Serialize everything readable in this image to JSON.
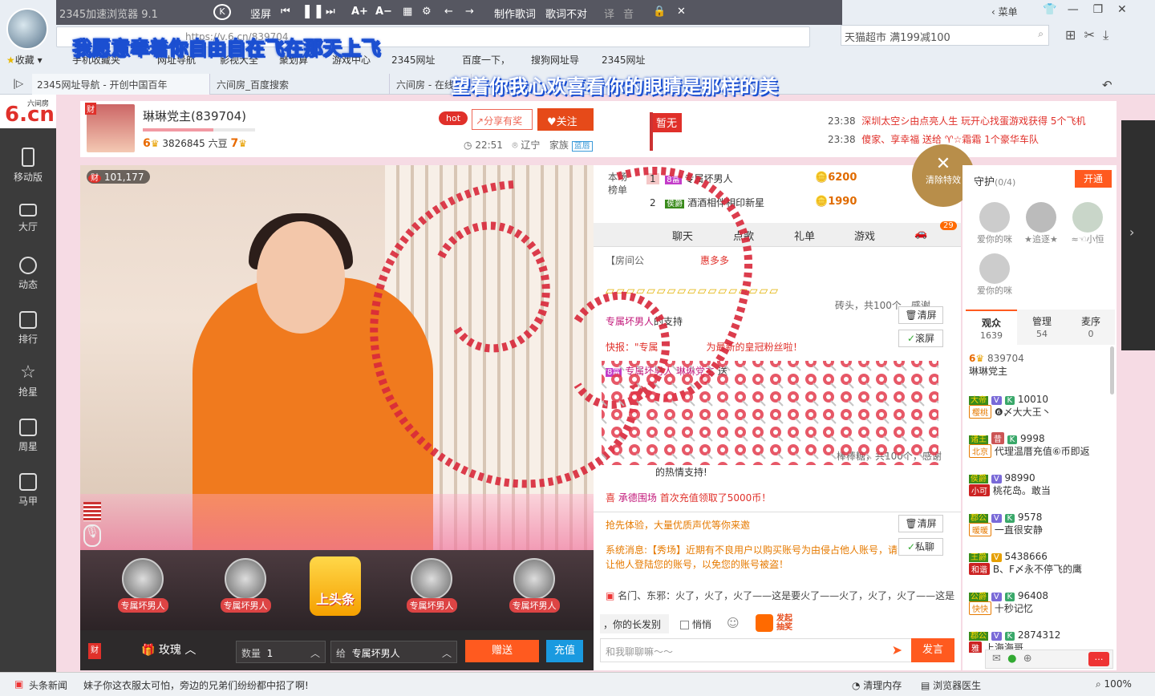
{
  "browser": {
    "app_title": "2345加速浏览器 9.1",
    "favorites": "收藏",
    "media_tools": {
      "vertical": "竖屏",
      "make_lyrics": "制作歌词",
      "lyrics_wrong": "歌词不对",
      "translate": "译",
      "sound": "音"
    },
    "address": "https://v.6.cn/839704",
    "search_placeholder": "天猫超市 满199减100",
    "menu": "菜单",
    "bookmarks": [
      "手机收藏夹",
      "网址导航",
      "影视大全",
      "聚划算",
      "游戏中心",
      "2345网址",
      "百度一下，",
      "搜狗网址导",
      "2345网址"
    ],
    "tabs": [
      "2345网址导航 - 开创中国百年",
      "六间房_百度搜索",
      "六间房 - 在线"
    ]
  },
  "lyrics": {
    "line1": "我愿意牵着你自由自在飞在那天上飞",
    "line2": "望着你我心欢喜看你的眼睛是那样的美"
  },
  "sidebar": [
    {
      "label": "移动版",
      "icon": "phone-icon"
    },
    {
      "label": "大厅",
      "icon": "tv-icon"
    },
    {
      "label": "动态",
      "icon": "compass-icon"
    },
    {
      "label": "排行",
      "icon": "crown-icon"
    },
    {
      "label": "抢星",
      "icon": "star-icon"
    },
    {
      "label": "周星",
      "icon": "gift-icon"
    },
    {
      "label": "马甲",
      "icon": "shirt-icon"
    }
  ],
  "site": {
    "logo_top": "六间房",
    "logo_main": "6.cn"
  },
  "anchor": {
    "name": "琳琳党主",
    "room_id": "(839704)",
    "level_left": "6",
    "beans": "3826845 六豆",
    "level_right": "7",
    "hot": "hot",
    "share": "分享有奖",
    "follow": "关注",
    "time": "22:51",
    "location": "辽宁",
    "family": "家族",
    "family_tag": "蓝唇",
    "status": "暂无"
  },
  "notices": [
    {
      "time": "23:38",
      "text": "深圳太空シ由点亮人生 玩开心找蛋游戏获得 5个飞机"
    },
    {
      "time": "23:38",
      "text": "傻家、享幸福 送给 ♈☆霜霜 1个豪华车队"
    }
  ],
  "video": {
    "counter": "101,177",
    "badge": "财"
  },
  "gift_slots": [
    "专属坏男人",
    "专属坏男人",
    "上头条",
    "专属坏男人",
    "专属坏男人"
  ],
  "gift_bar": {
    "gift_name": "玫瑰",
    "qty_label": "数量",
    "qty": "1",
    "to_label": "给",
    "to_name": "专属坏男人",
    "send": "赠送",
    "recharge": "充值"
  },
  "rank": {
    "label": "本场榜单",
    "rows": [
      {
        "n": "1",
        "badge": "8富",
        "name": "专属坏男人",
        "amount": "6200"
      },
      {
        "n": "2",
        "badge": "侯爵",
        "name": "酒酒相伴相印新星",
        "amount": "1990"
      }
    ]
  },
  "clear_effects": "清除特效",
  "chat_tabs": [
    "聊天",
    "点歌",
    "礼单",
    "游戏"
  ],
  "car_badge": "29",
  "chat": {
    "room_notice": "【房间公",
    "bonus": "惠多多",
    "gift_msg1": "砖头，共100个，感谢",
    "gift_msg1_user": "专属坏男人",
    "gift_msg1_tail": "的支持",
    "news": "快报：\"专属",
    "news_tail": "为最新的皇冠粉丝啦！",
    "sender": "专属坏男人",
    "to_anchor": "琳琳党主",
    "send_word": "送",
    "gift_msg2": "棒棒糖，共100个，感谢",
    "gift_msg2_tail": "的热情支持!",
    "recharge_msg_pre": "喜",
    "recharge_user": "承德围场",
    "recharge_msg": "首次充值领取了5000币！",
    "clear": "清屏",
    "scroll": "滚屏",
    "private": "私聊",
    "promo": "抢先体验，大量优质声优等你来邀",
    "system": "系统消息:【秀场】近期有不良用户以购买账号为由侵占他人账号，请",
    "system2": "让他人登陆您的账号，以免您的账号被盗！",
    "marquee": "名门、东邪：火了，火了，火了——这是要火了——火了，火了，火了——这是",
    "quick": "，你的长发别",
    "whisper": "悄悄",
    "lottery": "发起抽奖",
    "input_placeholder": "和我聊聊嘛～～",
    "send": "发言"
  },
  "guard": {
    "title": "守护",
    "count": "(0/4)",
    "open": "开通",
    "members": [
      "爱你的咪",
      "★追逐★",
      "≈☜小恒",
      "爱你的咪"
    ]
  },
  "audience_tabs": [
    {
      "label": "观众",
      "n": "1639"
    },
    {
      "label": "管理",
      "n": "54"
    },
    {
      "label": "麦序",
      "n": "0"
    }
  ],
  "audience": [
    {
      "lvl": "6",
      "id": "839704",
      "name": "琳琳党主",
      "tag": ""
    },
    {
      "lvl": "大帝",
      "id": "10010",
      "name": "❻〆大大王丶",
      "tag": "樱桃"
    },
    {
      "lvl": "诸王",
      "id": "9998",
      "name": "代理温厝充值⑥币即返",
      "tag": "北京"
    },
    {
      "lvl": "侯爵",
      "id": "98990",
      "name": "桃花岛。敢当",
      "tag": "小可"
    },
    {
      "lvl": "郡公",
      "id": "9578",
      "name": "一直很安静",
      "tag": "暖暖"
    },
    {
      "lvl": "王爵",
      "id": "5438666",
      "name": "B、F〆永不停飞的鹰",
      "tag": "和谐"
    },
    {
      "lvl": "公爵",
      "id": "96408",
      "name": "十秒记忆",
      "tag": "快快"
    },
    {
      "lvl": "郡公",
      "id": "2874312",
      "name": "上海海哥",
      "tag": "雅"
    }
  ],
  "status": {
    "news": "头条新闻",
    "ticker": "妹子你这衣服太可怕，旁边的兄弟们纷纷都中招了啊!",
    "clean": "清理内存",
    "doctor": "浏览器医生",
    "zoom": "100%"
  },
  "colors": {
    "accent": "#ff5a1f",
    "pink": "#c2187a",
    "brand": "#e0302a"
  }
}
